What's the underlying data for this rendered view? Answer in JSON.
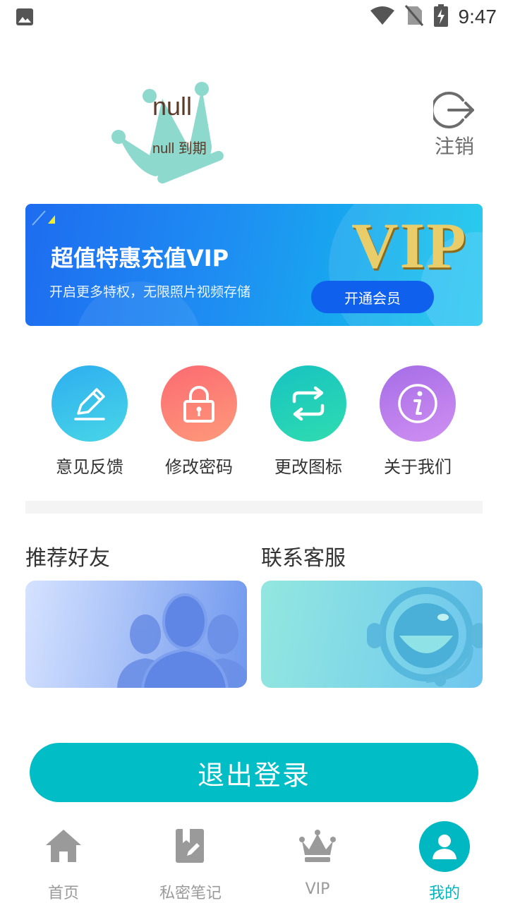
{
  "status_bar": {
    "time": "9:47"
  },
  "profile": {
    "username": "null",
    "expiry": "null 到期",
    "logout_label": "注销"
  },
  "vip_banner": {
    "title": "超值特惠充值VIP",
    "subtitle": "开启更多特权，无限照片视频存储",
    "button": "开通会员",
    "logo_text": "VIP"
  },
  "actions": [
    {
      "label": "意见反馈",
      "icon": "pencil-icon",
      "color": "#37bde8"
    },
    {
      "label": "修改密码",
      "icon": "lock-icon",
      "color": "#fb7773"
    },
    {
      "label": "更改图标",
      "icon": "swap-arrows-icon",
      "color": "#22cfb8"
    },
    {
      "label": "关于我们",
      "icon": "info-icon",
      "color": "#b67de8"
    }
  ],
  "sections": {
    "friends_title": "推荐好友",
    "service_title": "联系客服"
  },
  "logout_button": "退出登录",
  "bottom_nav": [
    {
      "label": "首页",
      "icon": "home-icon",
      "active": false
    },
    {
      "label": "私密笔记",
      "icon": "note-icon",
      "active": false
    },
    {
      "label": "VIP",
      "icon": "crown-icon",
      "active": false
    },
    {
      "label": "我的",
      "icon": "user-icon",
      "active": true
    }
  ],
  "colors": {
    "accent": "#00bdc6",
    "text": "#333333",
    "muted": "#9a9a9a"
  }
}
